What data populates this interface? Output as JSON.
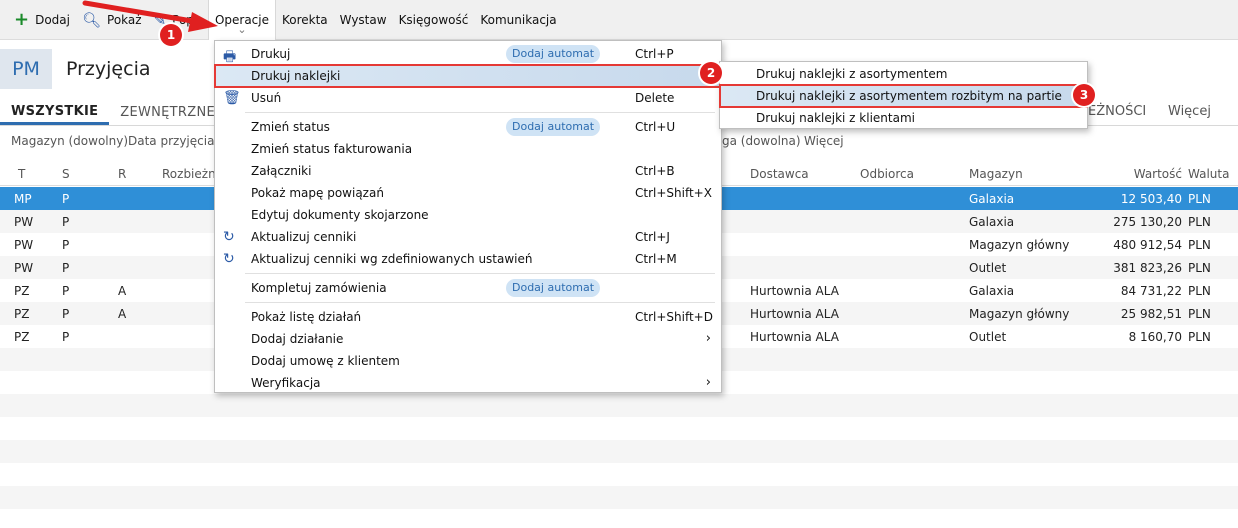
{
  "toolbar": {
    "add": "Dodaj",
    "show": "Pokaż",
    "edit": "Pop",
    "operations": "Operacje",
    "correction": "Korekta",
    "issue": "Wystaw",
    "accounting": "Księgowość",
    "communication": "Komunikacja"
  },
  "header": {
    "badge": "PM",
    "title": "Przyjęcia"
  },
  "tabs": {
    "all": "WSZYSTKIE",
    "external": "ZEWNĘTRZNE",
    "right1": "EŻNOŚCI",
    "more": "Więcej"
  },
  "filters": {
    "warehouse": "Magazyn (dowolny)",
    "date": "Data przyjęcia (d",
    "other": "ga (dowolna)",
    "more": "Więcej"
  },
  "table": {
    "headers": {
      "t": "T",
      "s": "S",
      "r": "R",
      "rozb": "Rozbieżn",
      "supplier": "Dostawca",
      "recipient": "Odbiorca",
      "warehouse": "Magazyn",
      "value": "Wartość",
      "currency": "Waluta"
    },
    "rows": [
      {
        "t": "MP",
        "s": "P",
        "r": "",
        "supplier": "",
        "warehouse": "Galaxia",
        "value": "12 503,40",
        "currency": "PLN"
      },
      {
        "t": "PW",
        "s": "P",
        "r": "",
        "supplier": "",
        "warehouse": "Galaxia",
        "value": "275 130,20",
        "currency": "PLN"
      },
      {
        "t": "PW",
        "s": "P",
        "r": "",
        "supplier": "",
        "warehouse": "Magazyn główny",
        "value": "480 912,54",
        "currency": "PLN"
      },
      {
        "t": "PW",
        "s": "P",
        "r": "",
        "supplier": "",
        "warehouse": "Outlet",
        "value": "381 823,26",
        "currency": "PLN"
      },
      {
        "t": "PZ",
        "s": "P",
        "r": "A",
        "supplier": "Hurtownia ALA",
        "warehouse": "Galaxia",
        "value": "84 731,22",
        "currency": "PLN"
      },
      {
        "t": "PZ",
        "s": "P",
        "r": "A",
        "supplier": "Hurtownia ALA",
        "warehouse": "Magazyn główny",
        "value": "25 982,51",
        "currency": "PLN"
      },
      {
        "t": "PZ",
        "s": "P",
        "r": "",
        "supplier": "Hurtownia ALA",
        "warehouse": "Outlet",
        "value": "8 160,70",
        "currency": "PLN"
      }
    ]
  },
  "menu": {
    "items": [
      {
        "label": "Drukuj",
        "pill": "Dodaj automat",
        "shortcut": "Ctrl+P"
      },
      {
        "label": "Drukuj naklejki"
      },
      {
        "label": "Usuń",
        "shortcut": "Delete"
      },
      {
        "label": "Zmień status",
        "pill": "Dodaj automat",
        "shortcut": "Ctrl+U"
      },
      {
        "label": "Zmień status fakturowania"
      },
      {
        "label": "Załączniki",
        "shortcut": "Ctrl+B"
      },
      {
        "label": "Pokaż mapę powiązań",
        "shortcut": "Ctrl+Shift+X"
      },
      {
        "label": "Edytuj dokumenty skojarzone"
      },
      {
        "label": "Aktualizuj cenniki",
        "shortcut": "Ctrl+J"
      },
      {
        "label": "Aktualizuj cenniki wg zdefiniowanych ustawień",
        "shortcut": "Ctrl+M"
      },
      {
        "label": "Kompletuj zamówienia",
        "pill": "Dodaj automat"
      },
      {
        "label": "Pokaż listę działań",
        "shortcut": "Ctrl+Shift+D"
      },
      {
        "label": "Dodaj działanie",
        "arrow": "›"
      },
      {
        "label": "Dodaj umowę z klientem"
      },
      {
        "label": "Weryfikacja",
        "arrow": "›"
      }
    ]
  },
  "submenu": {
    "items": [
      {
        "label": "Drukuj naklejki z asortymentem"
      },
      {
        "label": "Drukuj naklejki z asortymentem rozbitym na partie"
      },
      {
        "label": "Drukuj naklejki z klientami"
      }
    ]
  },
  "annotations": {
    "step1": "1",
    "step2": "2",
    "step3": "3"
  },
  "colors": {
    "accent": "#2e6db0",
    "selected_row": "#2f8fd7",
    "annotation": "#e02020"
  }
}
